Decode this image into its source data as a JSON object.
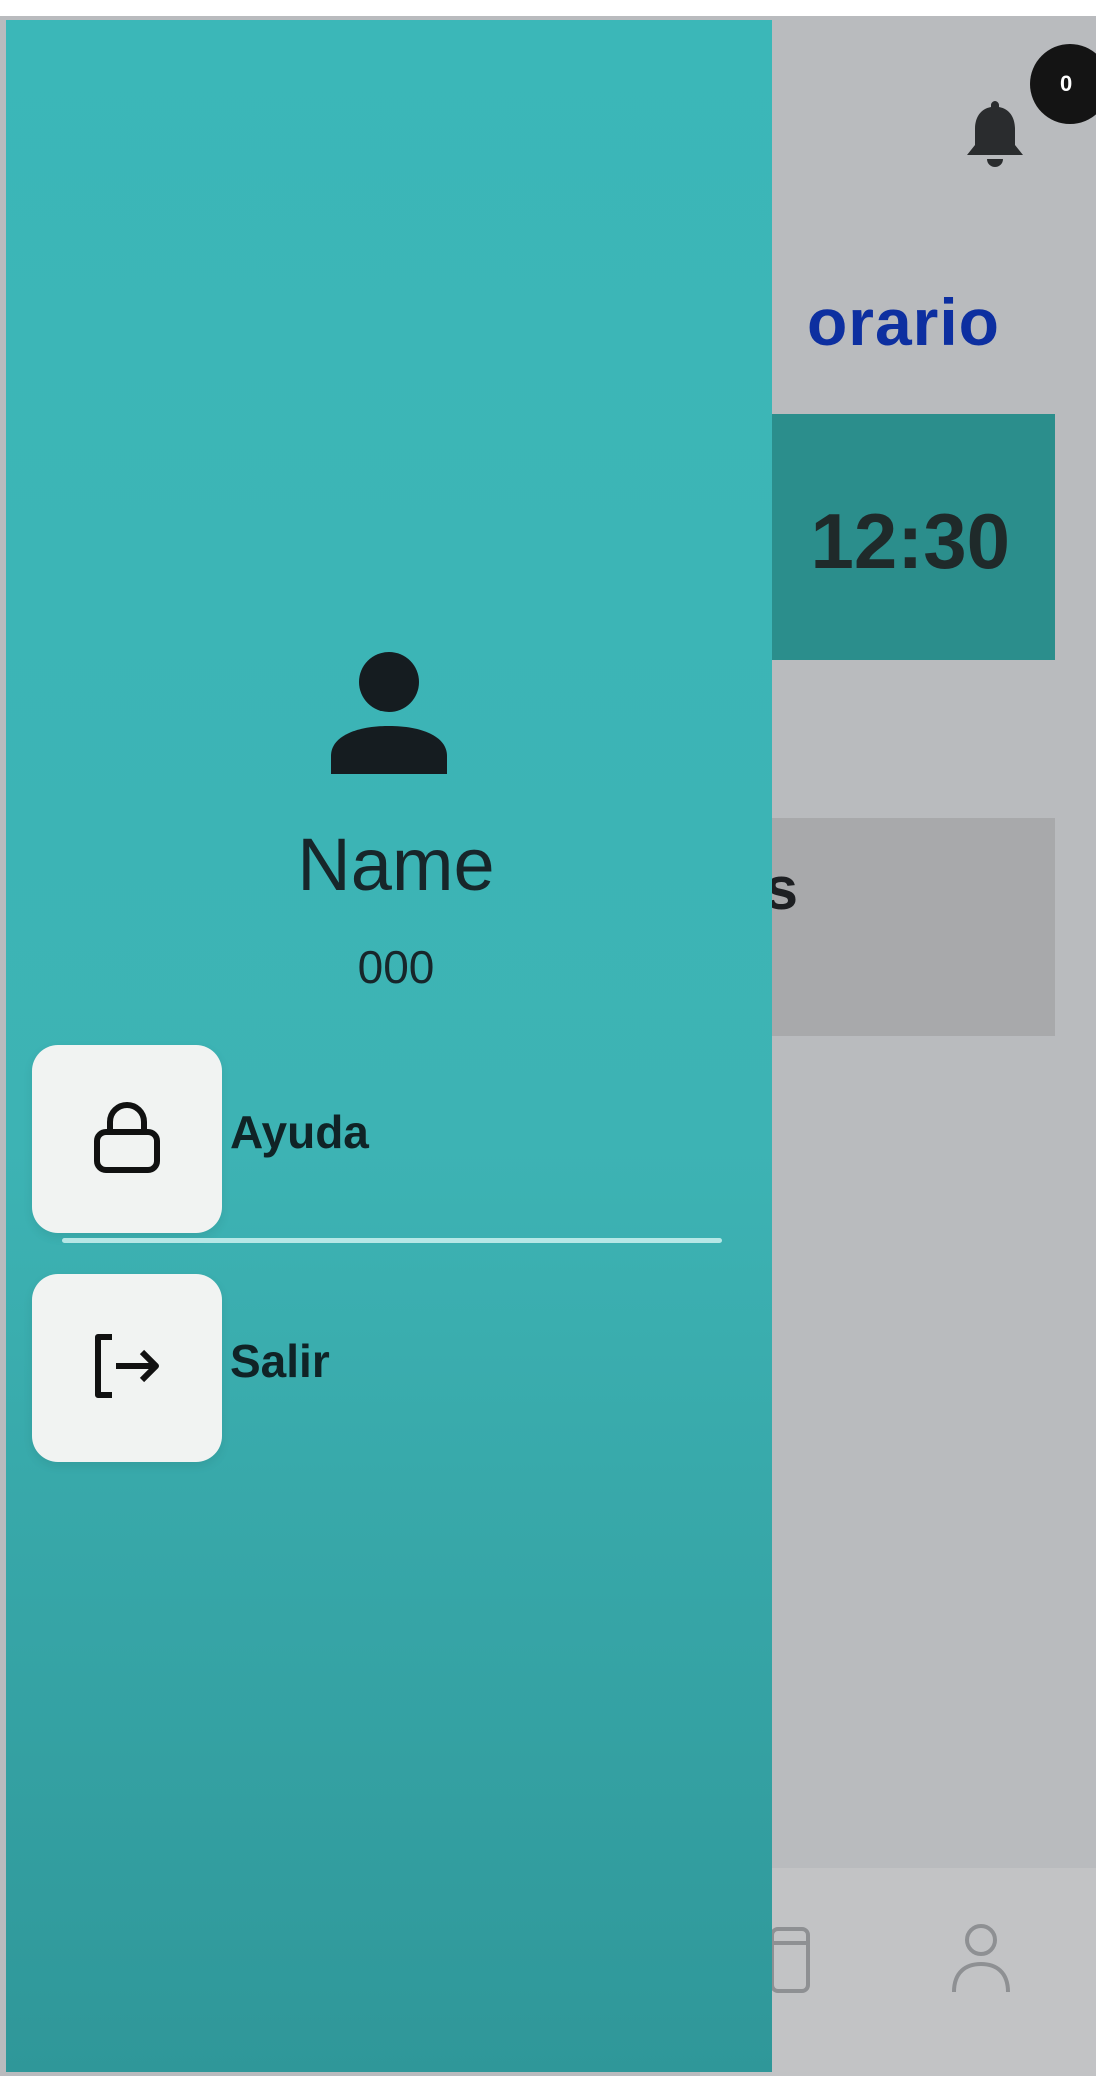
{
  "background": {
    "notifications": {
      "icon": "bell-icon",
      "badge_count": "0"
    },
    "title_partial": "orario",
    "time_card": {
      "text": "12:30",
      "color": "#2b8e8c"
    },
    "card_two": {
      "text_partial": "s"
    },
    "bottom_nav": {
      "icons": [
        "calendar-icon",
        "user-icon"
      ]
    }
  },
  "drawer": {
    "background_color": "#3bb7b8",
    "profile": {
      "icon": "person-icon",
      "name": "Name",
      "id": "000"
    },
    "menu": [
      {
        "label": "Ayuda",
        "icon": "lock-icon"
      },
      {
        "label": "Salir",
        "icon": "logout-icon"
      }
    ]
  }
}
